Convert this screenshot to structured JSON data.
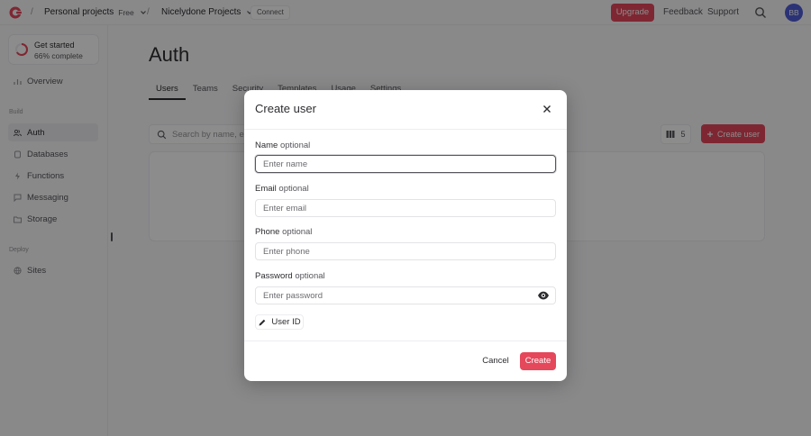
{
  "topbar": {
    "breadcrumb_org": "Personal projects",
    "breadcrumb_plan": "Free",
    "breadcrumb_project": "Nicelydone Projects",
    "connect_label": "Connect",
    "upgrade_label": "Upgrade",
    "feedback_label": "Feedback",
    "support_label": "Support",
    "avatar_initials": "BB"
  },
  "sidebar": {
    "progress_title": "Get started",
    "progress_sub": "66% complete",
    "progress_value": 0.66,
    "overview": "Overview",
    "build_section": "Build",
    "deploy_section": "Deploy",
    "items": [
      {
        "label": "Auth",
        "icon": "users-icon"
      },
      {
        "label": "Databases",
        "icon": "database-icon"
      },
      {
        "label": "Functions",
        "icon": "lightning-icon"
      },
      {
        "label": "Messaging",
        "icon": "send-icon"
      },
      {
        "label": "Storage",
        "icon": "folder-icon"
      }
    ],
    "sites": "Sites"
  },
  "main": {
    "title": "Auth",
    "tabs": [
      "Users",
      "Teams",
      "Security",
      "Templates",
      "Usage",
      "Settings"
    ],
    "search_placeholder": "Search by name, email, phone or ID",
    "columns_count": "5",
    "create_user_label": "Create user"
  },
  "modal": {
    "title": "Create user",
    "name_label": "Name",
    "name_placeholder": "Enter name",
    "email_label": "Email",
    "email_placeholder": "Enter email",
    "phone_label": "Phone",
    "phone_placeholder": "Enter phone",
    "password_label": "Password",
    "password_placeholder": "Enter password",
    "optional": "optional",
    "user_id_label": "User ID",
    "cancel_label": "Cancel",
    "create_label": "Create"
  },
  "colors": {
    "accent": "#e5475b",
    "avatar": "#4f5bd5"
  }
}
